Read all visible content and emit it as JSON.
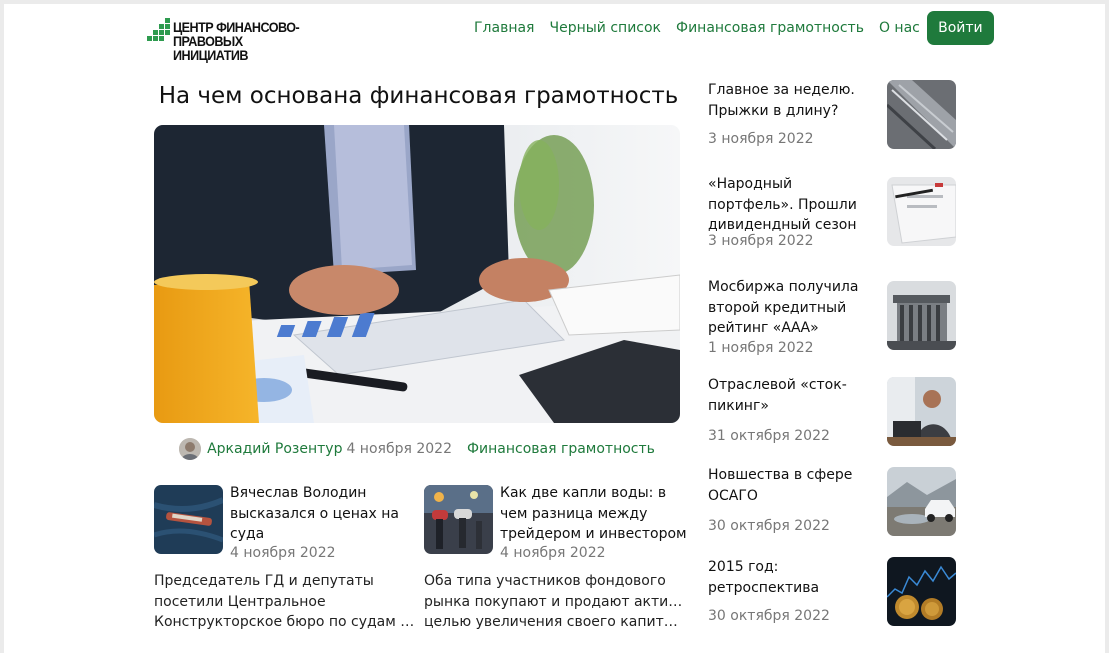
{
  "header": {
    "logo_lines": [
      "Центр финансово-",
      "правовых инициатив"
    ],
    "nav": [
      "Главная",
      "Черный список",
      "Финансовая грамотность",
      "О нас"
    ],
    "login_label": "Войти"
  },
  "main": {
    "title": "На чем основана финансовая грамотность",
    "author": "Аркадий Розентур",
    "date": "4 ноября 2022",
    "category": "Финансовая грамотность"
  },
  "cards": [
    {
      "title": "Вячеслав Володин высказался о ценах на суда",
      "date": "4 ноября 2022",
      "excerpt_lines": [
        "Председатель ГД и депутаты",
        "посетили Центральное",
        "Конструкторское бюро по судам на речных"
      ]
    },
    {
      "title": "Как две капли воды: в чем разница между трейдером и инвестором",
      "date": "4 ноября 2022",
      "excerpt_lines": [
        "Оба типа участников фондового",
        "рынка покупают и продают активы с",
        "целью увеличения своего капитала и прибыли"
      ]
    }
  ],
  "sidebar": [
    {
      "title": "Главное за неделю. Прыжки в длину?",
      "date": "3 ноября 2022"
    },
    {
      "title": "«Народный портфель». Прошли дивидендный сезон",
      "date": "3 ноября 2022"
    },
    {
      "title": "Мосбиржа получила второй кредитный рейтинг «ААА»",
      "date": "1 ноября 2022"
    },
    {
      "title": "Отраслевой «сток-пикинг»",
      "date": "31 октября 2022"
    },
    {
      "title": "Новшества в сфере ОСАГО",
      "date": "30 октября 2022"
    },
    {
      "title": "2015 год: ретроспектива",
      "date": "30 октября 2022"
    }
  ],
  "colors": {
    "brand_green": "#1f7a3c",
    "muted_text": "#777777",
    "logo_green": "#2e9b4f"
  },
  "icons": [
    "logo-mark-icon",
    "author-avatar"
  ]
}
